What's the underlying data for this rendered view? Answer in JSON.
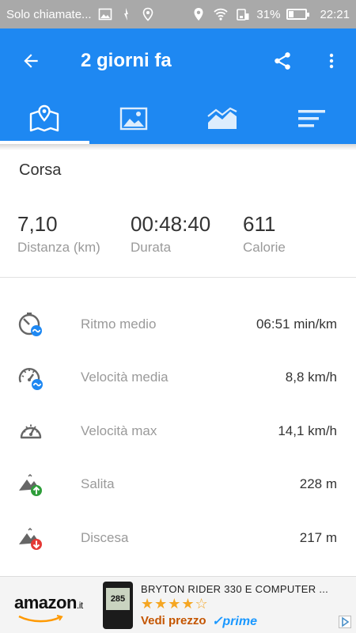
{
  "status_bar": {
    "carrier": "Solo chiamate...",
    "battery_text": "31%",
    "battery_level": 0.31,
    "time": "22:21"
  },
  "app_bar": {
    "title": "2 giorni fa",
    "icons": [
      "back-arrow-icon",
      "share-icon",
      "more-vert-icon"
    ]
  },
  "tabs": [
    {
      "icon": "map-icon",
      "active": true
    },
    {
      "icon": "image-icon",
      "active": false
    },
    {
      "icon": "area-chart-icon",
      "active": false
    },
    {
      "icon": "bar-list-icon",
      "active": false
    }
  ],
  "activity_type": "Corsa",
  "summary": [
    {
      "value": "7,10",
      "label": "Distanza (km)"
    },
    {
      "value": "00:48:40",
      "label": "Durata"
    },
    {
      "value": "611",
      "label": "Calorie"
    }
  ],
  "metrics": [
    {
      "icon": "pace-icon",
      "label": "Ritmo medio",
      "value": "06:51 min/km"
    },
    {
      "icon": "avg-speed-icon",
      "label": "Velocità media",
      "value": "8,8 km/h"
    },
    {
      "icon": "max-speed-icon",
      "label": "Velocità max",
      "value": "14,1 km/h"
    },
    {
      "icon": "ascent-icon",
      "label": "Salita",
      "value": "228 m"
    },
    {
      "icon": "descent-icon",
      "label": "Discesa",
      "value": "217 m"
    }
  ],
  "ad": {
    "brand": "amazon",
    "brand_tld": ".it",
    "product_screen": "285",
    "headline": "BRYTON RIDER 330 E COMPUTER ...",
    "stars": "★★★★☆",
    "cta": "Vedi prezzo",
    "badge": "✓prime"
  },
  "colors": {
    "primary": "#1e88f2",
    "status_bar": "#a9a9a9",
    "ascent_green": "#2e9e3a",
    "descent_red": "#e53935",
    "speed_blue": "#1e88f2"
  }
}
